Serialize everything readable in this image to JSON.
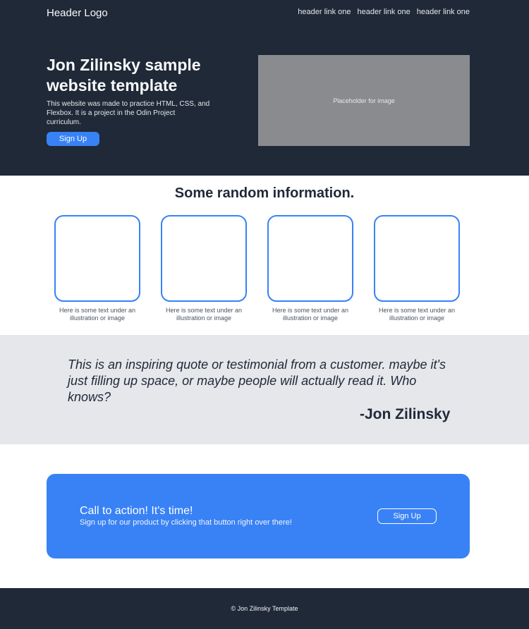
{
  "header": {
    "logo": "Header Logo",
    "links": [
      "header link one",
      "header link one",
      "header link one"
    ]
  },
  "hero": {
    "title": "Jon Zilinsky sample website template",
    "description": "This website was made to practice HTML, CSS, and Flexbox. It is a project in the Odin Project curriculum.",
    "signup_label": "Sign Up",
    "image_placeholder": "Placeholder for image"
  },
  "info": {
    "title": "Some random information.",
    "cards": [
      {
        "text": "Here is some text under an illustration or image"
      },
      {
        "text": "Here is some text under an illustration or image"
      },
      {
        "text": "Here is some text under an illustration or image"
      },
      {
        "text": "Here is some text under an illustration or image"
      }
    ]
  },
  "quote": {
    "text": "This is an inspiring quote or testimonial from a customer. maybe it's just filling up space, or maybe people will actually read it. Who knows?",
    "author": "-Jon Zilinsky"
  },
  "cta": {
    "title": "Call to action! It's time!",
    "subtitle": "Sign up for our product by clicking that button right over there!",
    "button_label": "Sign Up"
  },
  "footer": {
    "text": "© Jon Zilinsky Template"
  },
  "colors": {
    "dark": "#1f2937",
    "accent": "#3882f6",
    "light_gray": "#e5e7eb",
    "placeholder_gray": "#898b8f"
  }
}
